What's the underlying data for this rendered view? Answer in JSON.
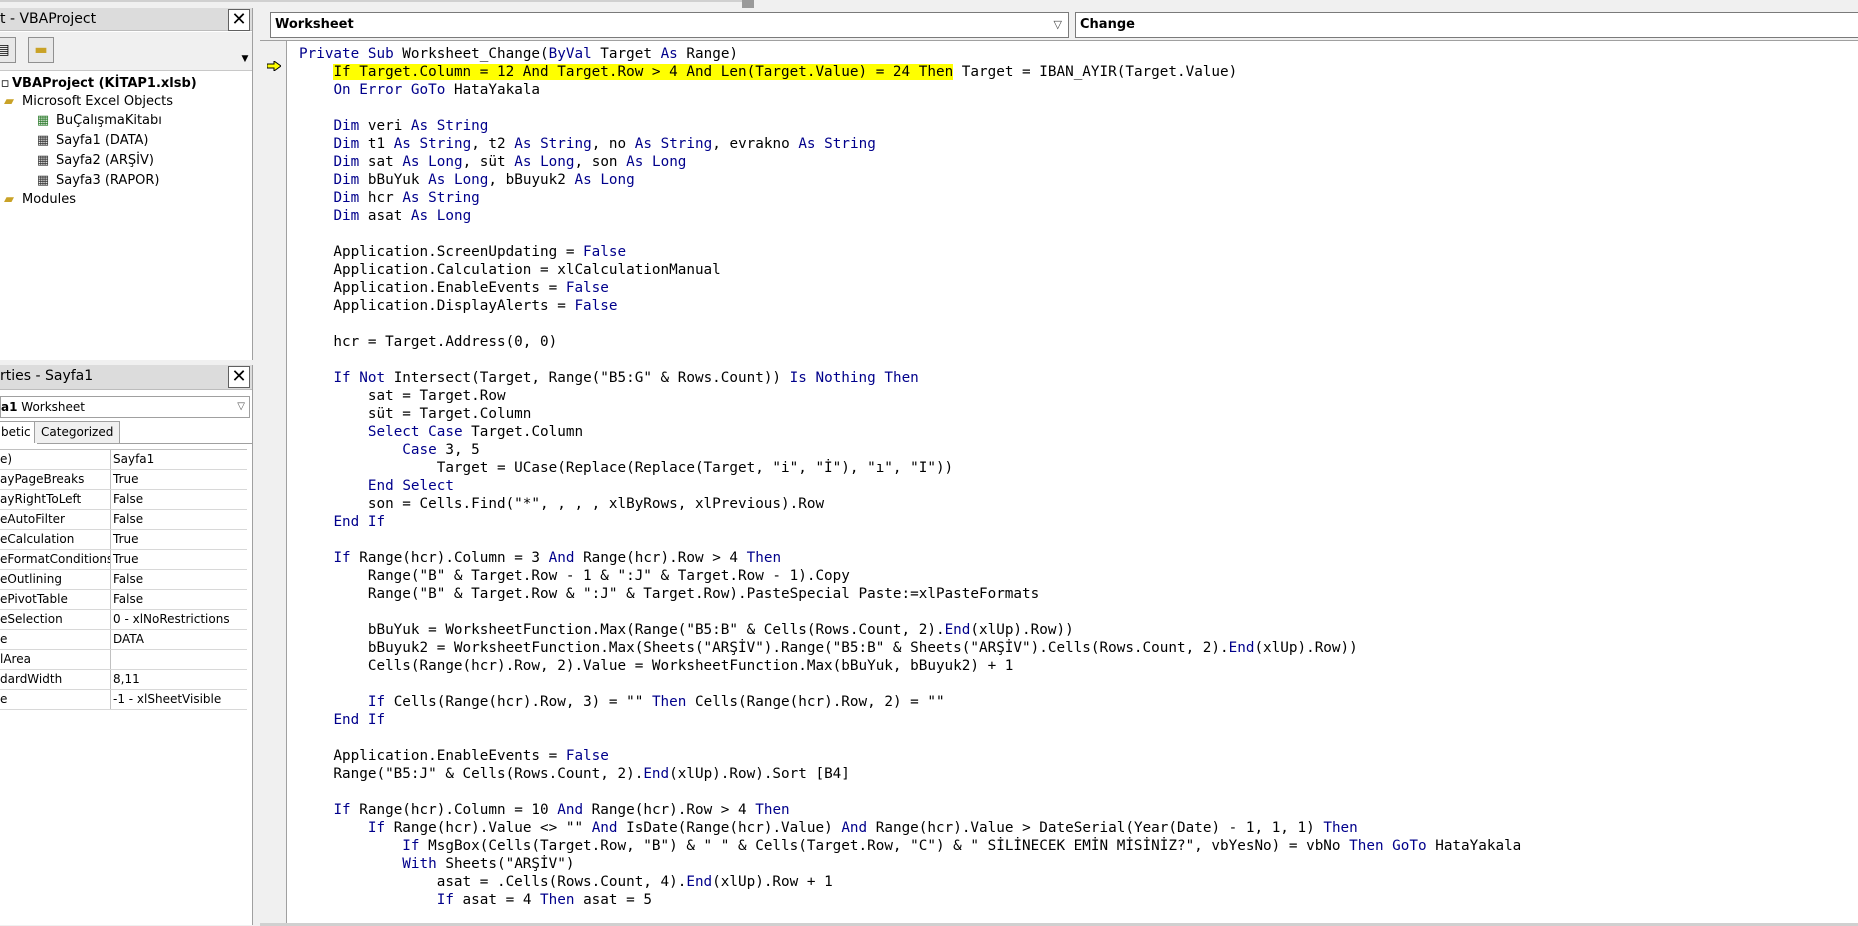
{
  "project_panel": {
    "title": "t - VBAProject",
    "root": "VBAProject (KİTAP1.xlsb)",
    "excel_objects_folder": "Microsoft Excel Objects",
    "items": [
      "BuÇalışmaKitabı",
      "Sayfa1 (DATA)",
      "Sayfa2 (ARŞİV)",
      "Sayfa3 (RAPOR)"
    ],
    "modules_folder": "Modules"
  },
  "properties_panel": {
    "title": "rties - Sayfa1",
    "object_name": "a1",
    "object_type": "Worksheet",
    "tabs": [
      "betic",
      "Categorized"
    ],
    "rows": [
      {
        "k": "e)",
        "v": "Sayfa1"
      },
      {
        "k": "ayPageBreaks",
        "v": "True"
      },
      {
        "k": "ayRightToLeft",
        "v": "False"
      },
      {
        "k": "eAutoFilter",
        "v": "False"
      },
      {
        "k": "eCalculation",
        "v": "True"
      },
      {
        "k": "eFormatConditions",
        "v": "True"
      },
      {
        "k": "eOutlining",
        "v": "False"
      },
      {
        "k": "ePivotTable",
        "v": "False"
      },
      {
        "k": "eSelection",
        "v": "0 - xlNoRestrictions"
      },
      {
        "k": "e",
        "v": "DATA"
      },
      {
        "k": "lArea",
        "v": ""
      },
      {
        "k": "dardWidth",
        "v": "8,11"
      },
      {
        "k": "e",
        "v": "-1 - xlSheetVisible"
      }
    ]
  },
  "code_window": {
    "object_combo": "Worksheet",
    "procedure_combo": "Change",
    "lines": [
      "Private Sub Worksheet_Change(ByVal Target As Range)",
      "    If Target.Column = 12 And Target.Row > 4 And Len(Target.Value) = 24 Then Target = IBAN_AYIR(Target.Value)",
      "    On Error GoTo HataYakala",
      "",
      "    Dim veri As String",
      "    Dim t1 As String, t2 As String, no As String, evrakno As String",
      "    Dim sat As Long, süt As Long, son As Long",
      "    Dim bBuYuk As Long, bBuyuk2 As Long",
      "    Dim hcr As String",
      "    Dim asat As Long",
      "",
      "    Application.ScreenUpdating = False",
      "    Application.Calculation = xlCalculationManual",
      "    Application.EnableEvents = False",
      "    Application.DisplayAlerts = False",
      "",
      "    hcr = Target.Address(0, 0)",
      "",
      "    If Not Intersect(Target, Range(\"B5:G\" & Rows.Count)) Is Nothing Then",
      "        sat = Target.Row",
      "        süt = Target.Column",
      "        Select Case Target.Column",
      "            Case 3, 5",
      "                Target = UCase(Replace(Replace(Target, \"i\", \"İ\"), \"ı\", \"I\"))",
      "        End Select",
      "        son = Cells.Find(\"*\", , , , xlByRows, xlPrevious).Row",
      "    End If",
      "",
      "    If Range(hcr).Column = 3 And Range(hcr).Row > 4 Then",
      "        Range(\"B\" & Target.Row - 1 & \":J\" & Target.Row - 1).Copy",
      "        Range(\"B\" & Target.Row & \":J\" & Target.Row).PasteSpecial Paste:=xlPasteFormats",
      "",
      "        bBuYuk = WorksheetFunction.Max(Range(\"B5:B\" & Cells(Rows.Count, 2).End(xlUp).Row))",
      "        bBuyuk2 = WorksheetFunction.Max(Sheets(\"ARŞİV\").Range(\"B5:B\" & Sheets(\"ARŞİV\").Cells(Rows.Count, 2).End(xlUp).Row))",
      "        Cells(Range(hcr).Row, 2).Value = WorksheetFunction.Max(bBuYuk, bBuyuk2) + 1",
      "",
      "        If Cells(Range(hcr).Row, 3) = \"\" Then Cells(Range(hcr).Row, 2) = \"\"",
      "    End If",
      "",
      "    Application.EnableEvents = False",
      "    Range(\"B5:J\" & Cells(Rows.Count, 2).End(xlUp).Row).Sort [B4]",
      "",
      "    If Range(hcr).Column = 10 And Range(hcr).Row > 4 Then",
      "        If Range(hcr).Value <> \"\" And IsDate(Range(hcr).Value) And Range(hcr).Value > DateSerial(Year(Date) - 1, 1, 1) Then",
      "            If MsgBox(Cells(Target.Row, \"B\") & \" \" & Cells(Target.Row, \"C\") & \" SİLİNECEK EMİN MİSİNİZ?\", vbYesNo) = vbNo Then GoTo HataYakala",
      "            With Sheets(\"ARŞİV\")",
      "                asat = .Cells(Rows.Count, 4).End(xlUp).Row + 1",
      "                If asat = 4 Then asat = 5"
    ],
    "highlighted_line": 1,
    "highlighted_text": "If Target.Column = 12 And Target.Row > 4 And Len(Target.Value) = 24 Then"
  },
  "colors": {
    "keyword": "#00008b",
    "highlight": "#ffff00"
  }
}
